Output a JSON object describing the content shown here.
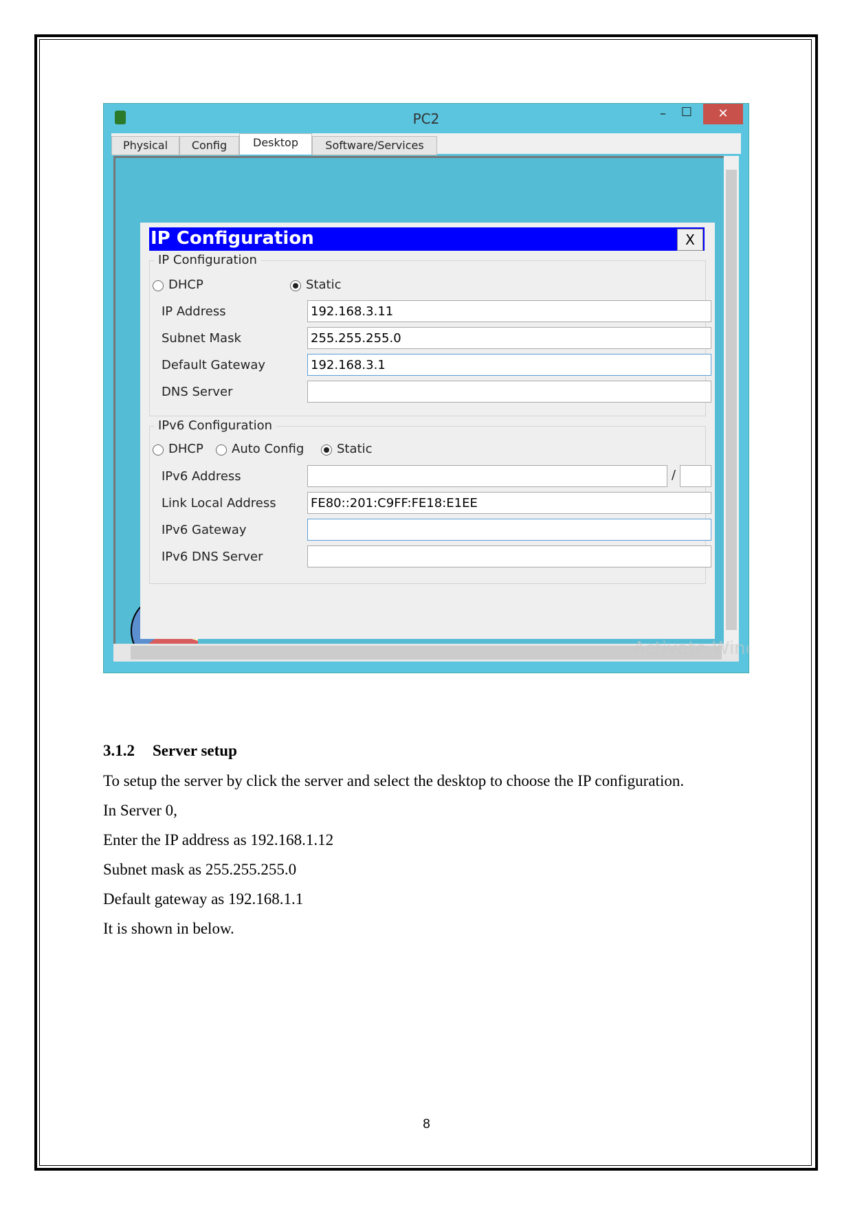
{
  "window": {
    "title": "PC2",
    "close": "✕",
    "minimize": "–",
    "maximize": "☐",
    "tabs": [
      "Physical",
      "Config",
      "Desktop",
      "Software/Services"
    ],
    "active_tab": "Desktop"
  },
  "dialog": {
    "title": "IP Configuration",
    "close": "X",
    "ipv4": {
      "legend": "IP Configuration",
      "dhcp": "DHCP",
      "static": "Static",
      "mode": "Static",
      "fields": [
        {
          "label": "IP Address",
          "value": "192.168.3.11"
        },
        {
          "label": "Subnet Mask",
          "value": "255.255.255.0"
        },
        {
          "label": "Default Gateway",
          "value": "192.168.3.1"
        },
        {
          "label": "DNS Server",
          "value": ""
        }
      ]
    },
    "ipv6": {
      "legend": "IPv6 Configuration",
      "dhcp": "DHCP",
      "auto": "Auto Config",
      "static": "Static",
      "mode": "Static",
      "fields": [
        {
          "label": "IPv6 Address",
          "value": "",
          "prefix": ""
        },
        {
          "label": "Link Local Address",
          "value": "FE80::201:C9FF:FE18:E1EE"
        },
        {
          "label": "IPv6 Gateway",
          "value": ""
        },
        {
          "label": "IPv6 DNS Server",
          "value": ""
        }
      ],
      "slash": "/"
    }
  },
  "watermark": "Activate Windows",
  "doc": {
    "heading_num": "3.1.2",
    "heading": "Server setup",
    "lines": [
      "To setup the server by click the server and select the desktop to choose the IP configuration.",
      "In Server 0,",
      "Enter the IP address as 192.168.1.12",
      "Subnet mask as 255.255.255.0",
      "Default gateway as 192.168.1.1",
      "It is shown in below."
    ],
    "page_number": "8"
  }
}
